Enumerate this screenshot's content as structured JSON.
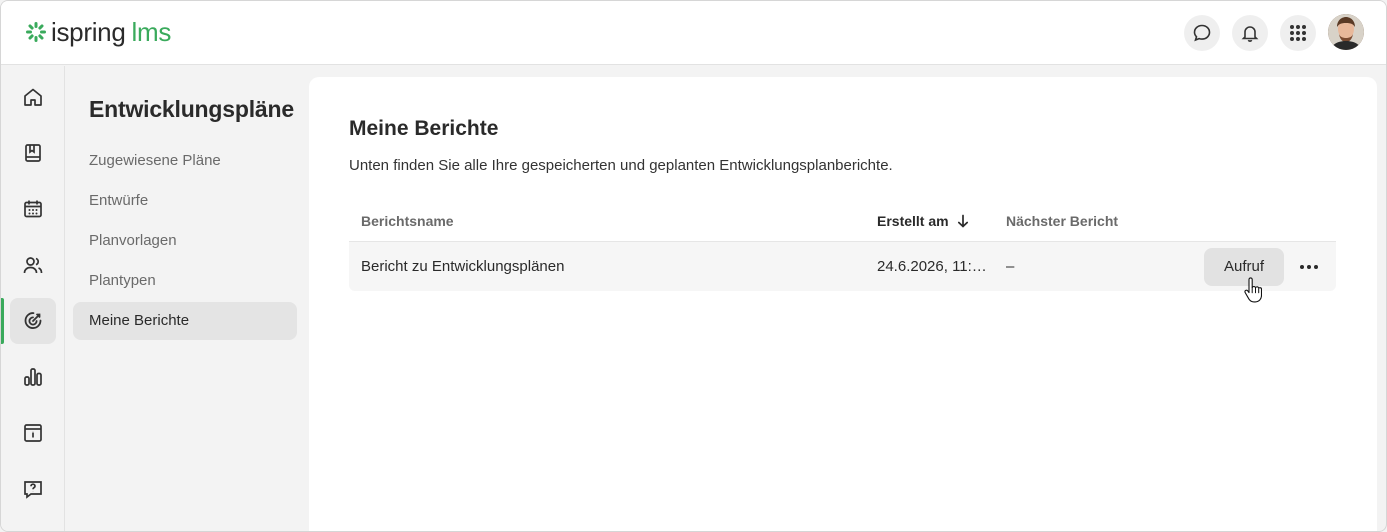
{
  "brand": {
    "name_main": "ispring",
    "name_accent": "lms",
    "accent_color": "#3aaa5c"
  },
  "header": {
    "icons": [
      "chat-icon",
      "bell-icon",
      "apps-grid-icon"
    ],
    "avatar": "user-avatar"
  },
  "rail": {
    "items": [
      {
        "icon": "home-icon"
      },
      {
        "icon": "book-icon"
      },
      {
        "icon": "calendar-icon"
      },
      {
        "icon": "users-icon"
      },
      {
        "icon": "target-icon",
        "active": true
      },
      {
        "icon": "bar-chart-icon"
      },
      {
        "icon": "archive-icon"
      },
      {
        "icon": "help-chat-icon"
      }
    ]
  },
  "subnav": {
    "title": "Entwicklungspläne",
    "items": [
      {
        "label": "Zugewiesene Pläne"
      },
      {
        "label": "Entwürfe"
      },
      {
        "label": "Planvorlagen"
      },
      {
        "label": "Plantypen"
      },
      {
        "label": "Meine Berichte",
        "active": true
      }
    ]
  },
  "main": {
    "title": "Meine Berichte",
    "description": "Unten finden Sie alle Ihre gespeicherten und geplanten Entwicklungsplanberichte.",
    "table": {
      "columns": [
        "Berichtsname",
        "Erstellt am",
        "Nächster Bericht"
      ],
      "rows": [
        {
          "name": "Bericht zu Entwicklungsplänen",
          "created": "24.6.2026, 11:…",
          "next": "–",
          "action": "Aufruf"
        }
      ]
    }
  }
}
